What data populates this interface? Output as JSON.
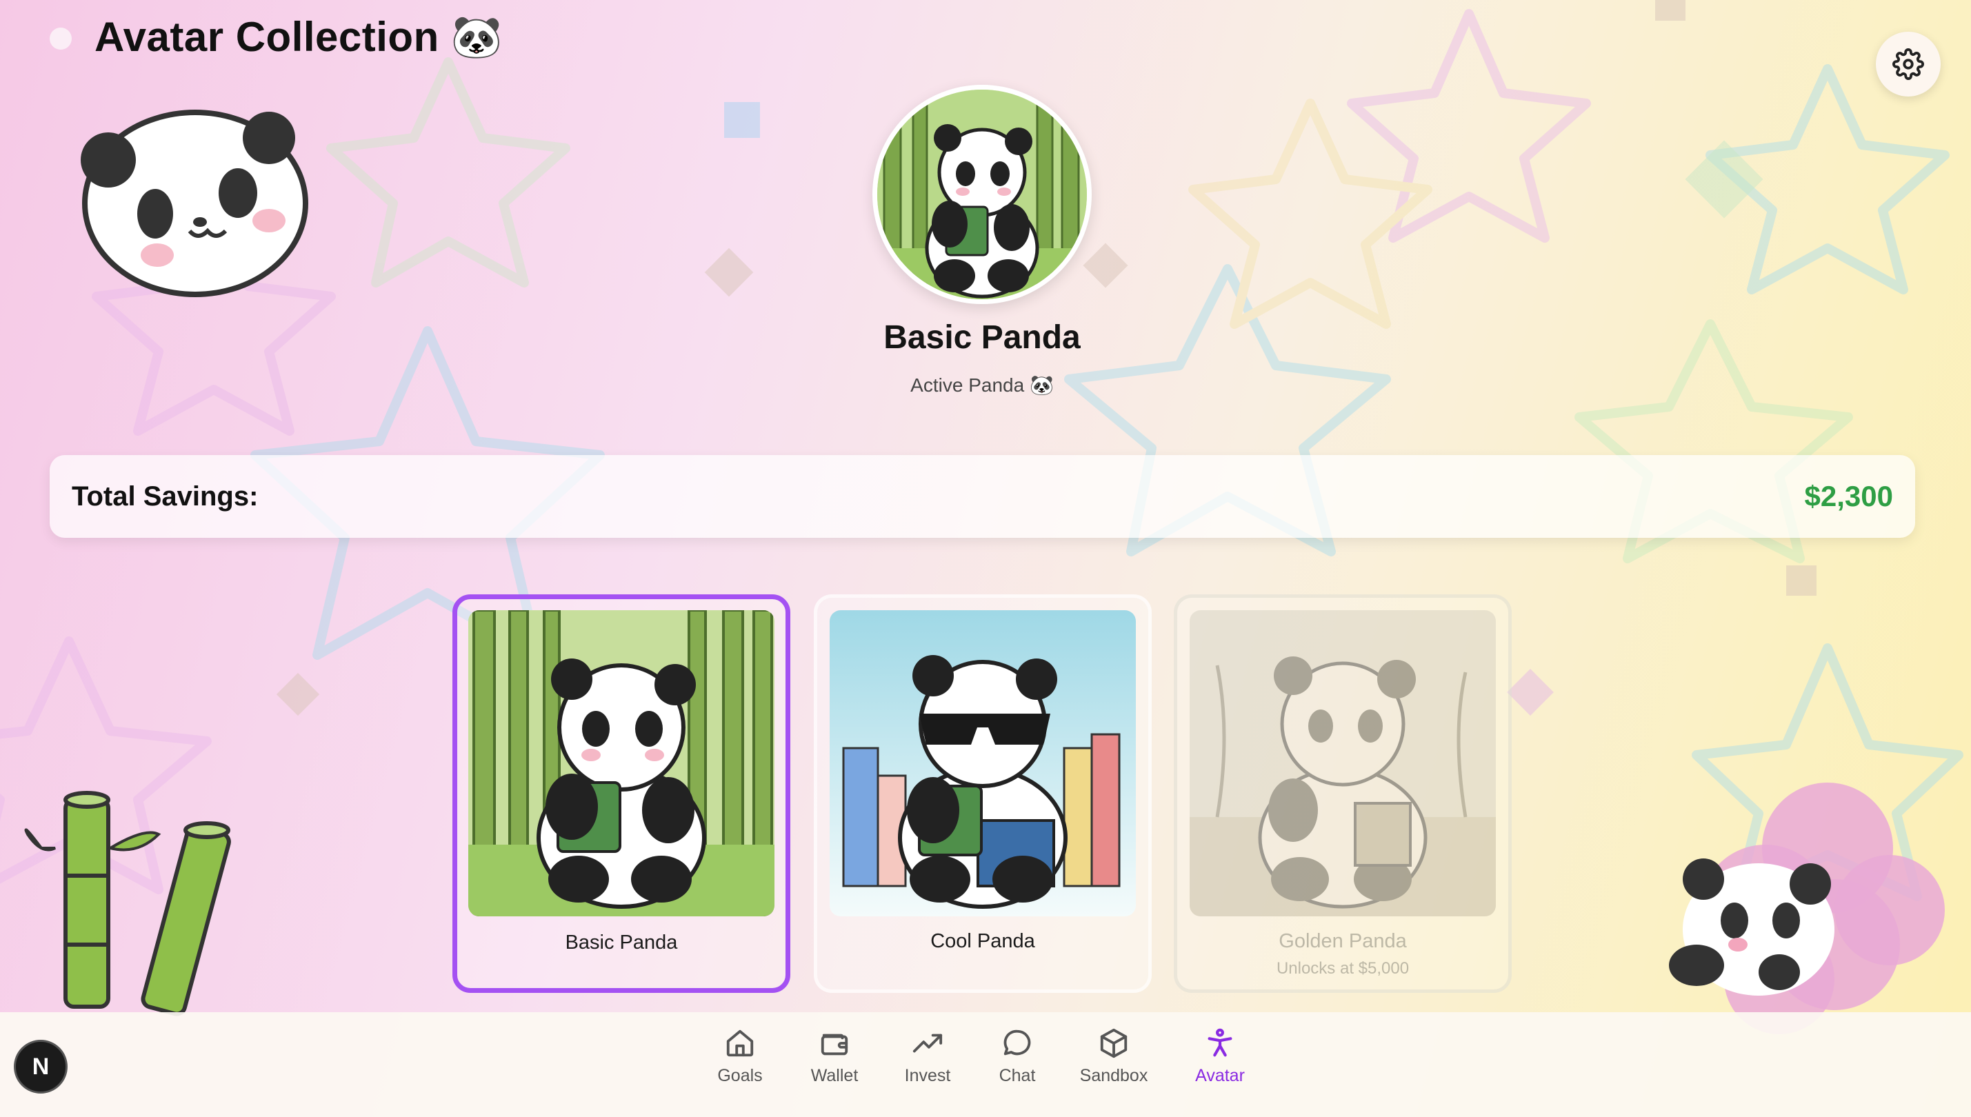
{
  "header": {
    "title": "Avatar Collection 🐼"
  },
  "hero": {
    "name": "Basic Panda",
    "subtitle": "Active Panda 🐼"
  },
  "savings": {
    "label": "Total Savings:",
    "value": "$2,300",
    "value_color": "#2e9e44"
  },
  "cards": [
    {
      "name": "Basic Panda",
      "state": "selected",
      "scene": "bamboo forest"
    },
    {
      "name": "Cool Panda",
      "state": "unlocked",
      "scene": "city with sunglasses"
    },
    {
      "name": "Golden Panda",
      "state": "locked",
      "unlock_text": "Unlocks at $5,000",
      "scene": "beach"
    }
  ],
  "nav": {
    "items": [
      {
        "label": "Goals",
        "icon": "home-icon"
      },
      {
        "label": "Wallet",
        "icon": "wallet-icon"
      },
      {
        "label": "Invest",
        "icon": "trending-up-icon"
      },
      {
        "label": "Chat",
        "icon": "chat-bubble-icon"
      },
      {
        "label": "Sandbox",
        "icon": "cube-icon"
      },
      {
        "label": "Avatar",
        "icon": "person-icon",
        "active": true
      }
    ],
    "active_color": "#8a2be2"
  },
  "badge": {
    "letter": "N"
  },
  "colors": {
    "accent": "#a451f2"
  }
}
